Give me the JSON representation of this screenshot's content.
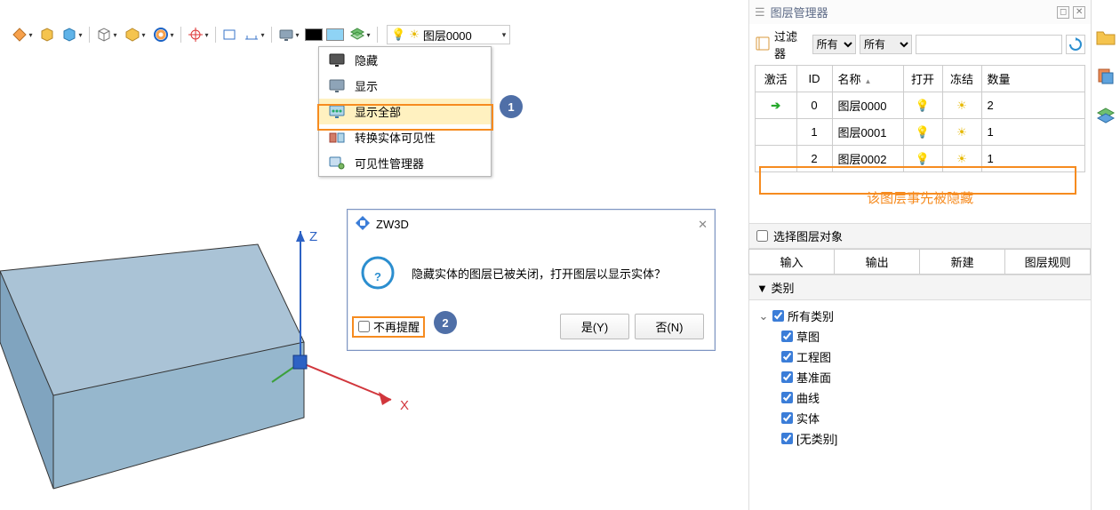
{
  "toolbar": {
    "layer_current": "图层0000"
  },
  "dropdown": {
    "items": [
      {
        "label": "隐藏"
      },
      {
        "label": "显示"
      },
      {
        "label": "显示全部"
      },
      {
        "label": "转换实体可见性"
      },
      {
        "label": "可见性管理器"
      }
    ]
  },
  "callouts": {
    "one": "1",
    "two": "2"
  },
  "axes": {
    "z": "Z",
    "x": "X"
  },
  "dialog": {
    "title": "ZW3D",
    "message": "隐藏实体的图层已被关闭，打开图层以显示实体？",
    "dont_remind": "不再提醒",
    "yes": "是(Y)",
    "no": "否(N)"
  },
  "panel": {
    "title": "图层管理器",
    "filter_label": "过滤器",
    "filter_all": "所有",
    "columns": {
      "active": "激活",
      "id": "ID",
      "name": "名称",
      "open": "打开",
      "freeze": "冻结",
      "count": "数量"
    },
    "rows": [
      {
        "active": true,
        "id": "0",
        "name": "图层0000",
        "open": true,
        "count": "2"
      },
      {
        "active": false,
        "id": "1",
        "name": "图层0001",
        "open": true,
        "count": "1"
      },
      {
        "active": false,
        "id": "2",
        "name": "图层0002",
        "open": false,
        "count": "1"
      }
    ],
    "note": "该图层事先被隐藏",
    "select_obj": "选择图层对象",
    "buttons": {
      "import": "输入",
      "export": "输出",
      "new": "新建",
      "rules": "图层规则"
    },
    "categories_header": "类别",
    "categories": {
      "root": "所有类别",
      "items": [
        "草图",
        "工程图",
        "基准面",
        "曲线",
        "实体",
        "[无类别]"
      ]
    }
  }
}
